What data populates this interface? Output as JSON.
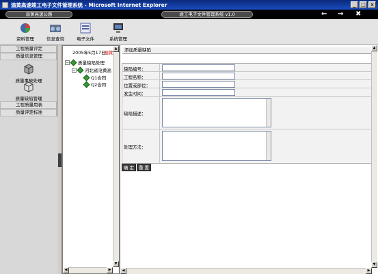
{
  "window": {
    "title": "渝黄高速竣工电子文件管理系统 - Microsoft Internet Explorer",
    "controls": [
      "_",
      "□",
      "×"
    ]
  },
  "topbar": {
    "project": "渝黄高速公路",
    "system": "竣工电子文件管理系统 v1.0",
    "back_icon": "arrow-left",
    "forward_icon": "arrow-right",
    "close_icon": "x"
  },
  "toolbar": {
    "items": [
      "资料管理",
      "信息查询",
      "电子文件",
      "系统管理"
    ]
  },
  "sidebar": {
    "sections": [
      "工程质量评定",
      "质量信息管理",
      "工程质量用表",
      "质量评定标准"
    ],
    "items": [
      "质量事故处理",
      "质量缺陷管理"
    ]
  },
  "tree": {
    "date": "2005年5月17日",
    "weekday": "星期二",
    "root": "质量缺陷处理",
    "child": "河北省沧黄高",
    "leaves": [
      "Q1合同",
      "Q2合同"
    ]
  },
  "content": {
    "title": "添加质量缺陷",
    "fields": [
      {
        "label": "缺陷编号：",
        "value": ""
      },
      {
        "label": "工程名称：",
        "value": ""
      },
      {
        "label": "位置或部位：",
        "value": ""
      },
      {
        "label": "发生时间：",
        "value": ""
      },
      {
        "label": "缺陷描述：",
        "value": ""
      },
      {
        "label": "处理方法：",
        "value": ""
      }
    ],
    "buttons": [
      "确 定",
      "重 置"
    ]
  }
}
